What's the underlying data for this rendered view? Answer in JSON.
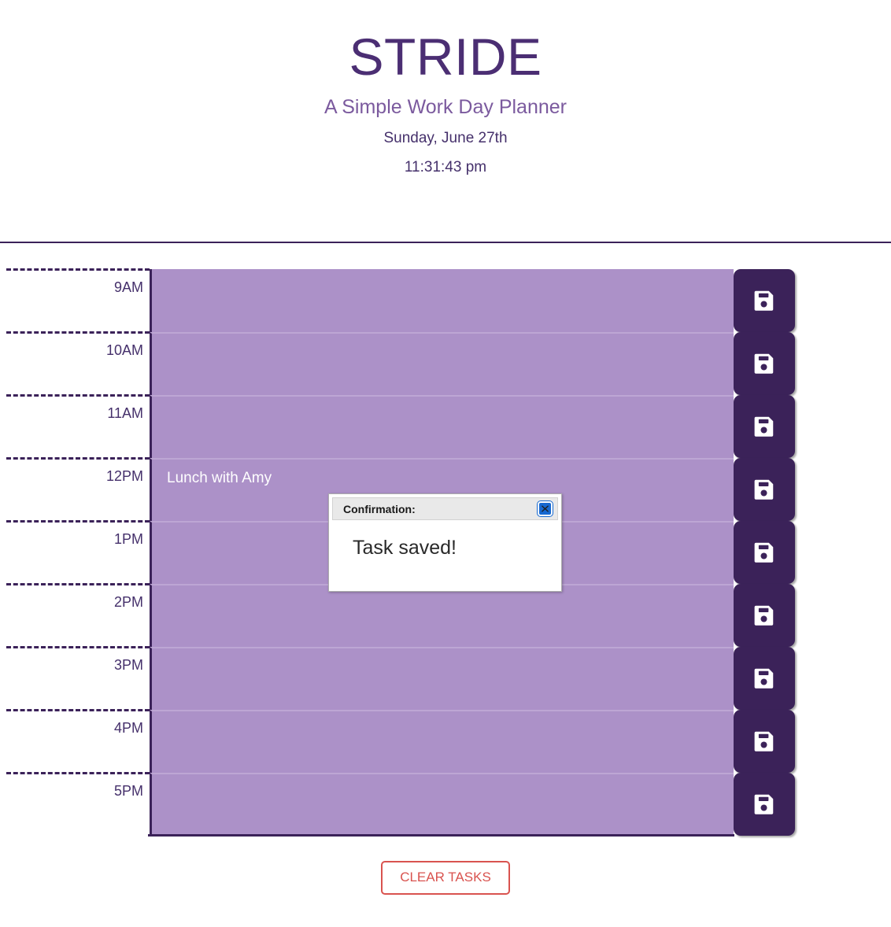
{
  "header": {
    "title": "STRIDE",
    "subtitle": "A Simple Work Day Planner",
    "date": "Sunday, June 27th",
    "time": "11:31:43 pm",
    "title_color": "#4b2e73",
    "subtitle_color": "#7b5a9e",
    "rule_color": "#3b2259"
  },
  "schedule": {
    "row_color": "#ac91c8",
    "save_button_color": "#3b2259",
    "save_icon": "floppy-disk-save-icon",
    "rows": [
      {
        "hour": "9AM",
        "task": ""
      },
      {
        "hour": "10AM",
        "task": ""
      },
      {
        "hour": "11AM",
        "task": ""
      },
      {
        "hour": "12PM",
        "task": "Lunch with Amy"
      },
      {
        "hour": "1PM",
        "task": ""
      },
      {
        "hour": "2PM",
        "task": ""
      },
      {
        "hour": "3PM",
        "task": ""
      },
      {
        "hour": "4PM",
        "task": ""
      },
      {
        "hour": "5PM",
        "task": ""
      }
    ]
  },
  "clear": {
    "label": "CLEAR TASKS",
    "color": "#d9534f"
  },
  "modal": {
    "title": "Confirmation:",
    "message": "Task saved!",
    "close_icon": "close-x-icon",
    "close_color": "#1668d0"
  }
}
